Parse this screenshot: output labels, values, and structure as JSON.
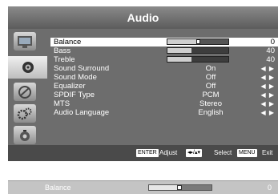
{
  "menu": {
    "title": "Audio",
    "side_icons": [
      "picture-icon",
      "audio-icon",
      "satellite-icon",
      "settings-icon",
      "lock-icon"
    ],
    "active_icon": 1,
    "items": [
      {
        "label": "Balance",
        "type": "bar",
        "value": "0",
        "level": 0.5,
        "selected": true
      },
      {
        "label": "Bass",
        "type": "bar",
        "value": "40",
        "level": 0.4
      },
      {
        "label": "Treble",
        "type": "bar",
        "value": "40",
        "level": 0.4
      },
      {
        "label": "Sound Surround",
        "type": "option",
        "value": "On"
      },
      {
        "label": "Sound Mode",
        "type": "option",
        "value": "Off"
      },
      {
        "label": "Equalizer",
        "type": "option",
        "value": "Off"
      },
      {
        "label": "SPDIF Type",
        "type": "option",
        "value": "PCM"
      },
      {
        "label": "MTS",
        "type": "option",
        "value": "Stereo"
      },
      {
        "label": "Audio Language",
        "type": "option",
        "value": "English"
      }
    ],
    "arrows": "◀ ▶"
  },
  "footer": {
    "enter_key": "ENTER",
    "adjust": "Adjust",
    "arrows_key": "◂▸/▴▾",
    "select": "Select",
    "menu_key": "MENU",
    "exit": "Exit"
  },
  "strip": {
    "label": "Balance",
    "value": "0",
    "level": 0.5
  }
}
